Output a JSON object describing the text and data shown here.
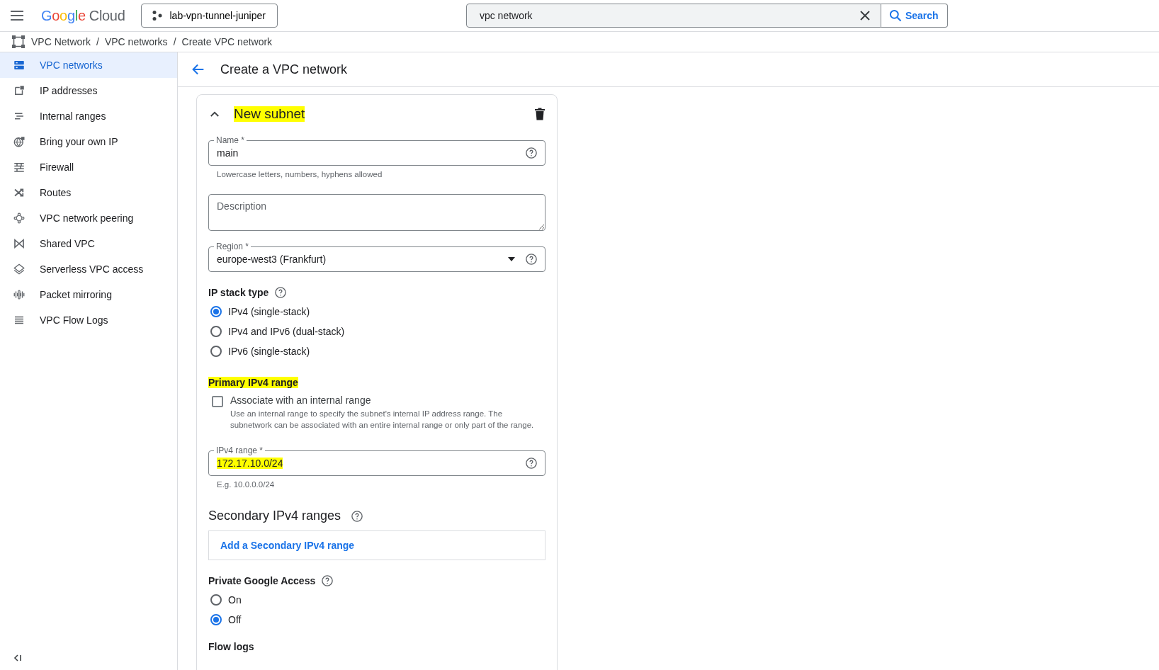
{
  "top_bar": {
    "logo": {
      "brand": "Google",
      "product": "Cloud"
    },
    "project": "lab-vpn-tunnel-juniper",
    "search": {
      "value": "vpc network",
      "button": "Search"
    }
  },
  "breadcrumbs": [
    "VPC Network",
    "VPC networks",
    "Create VPC network"
  ],
  "breadcrumb_separator": "/",
  "sidebar": {
    "items": [
      {
        "label": "VPC networks",
        "selected": true
      },
      {
        "label": "IP addresses",
        "selected": false
      },
      {
        "label": "Internal ranges",
        "selected": false
      },
      {
        "label": "Bring your own IP",
        "selected": false
      },
      {
        "label": "Firewall",
        "selected": false
      },
      {
        "label": "Routes",
        "selected": false
      },
      {
        "label": "VPC network peering",
        "selected": false
      },
      {
        "label": "Shared VPC",
        "selected": false
      },
      {
        "label": "Serverless VPC access",
        "selected": false
      },
      {
        "label": "Packet mirroring",
        "selected": false
      },
      {
        "label": "VPC Flow Logs",
        "selected": false
      }
    ]
  },
  "page": {
    "title": "Create a VPC network"
  },
  "subnet_card": {
    "title": "New subnet",
    "title_highlighted": true,
    "expanded": true,
    "name_field": {
      "label": "Name *",
      "value": "main",
      "hint": "Lowercase letters, numbers, hyphens allowed"
    },
    "description_field": {
      "placeholder": "Description"
    },
    "region_field": {
      "label": "Region *",
      "value": "europe-west3 (Frankfurt)"
    },
    "ip_stack": {
      "label": "IP stack type",
      "options": [
        {
          "label": "IPv4 (single-stack)",
          "selected": true
        },
        {
          "label": "IPv4 and IPv6 (dual-stack)",
          "selected": false
        },
        {
          "label": "IPv6 (single-stack)",
          "selected": false
        }
      ]
    },
    "primary_range": {
      "heading": "Primary IPv4 range",
      "heading_highlighted": true,
      "associate": {
        "label": "Associate with an internal range",
        "checked": false,
        "description": "Use an internal range to specify the subnet's internal IP address range. The subnetwork can be associated with an entire internal range or only part of the range."
      },
      "ipv4_field": {
        "label": "IPv4 range *",
        "value": "172.17.10.0/24",
        "value_highlighted": true,
        "hint": "E.g. 10.0.0.0/24"
      }
    },
    "secondary": {
      "heading": "Secondary IPv4 ranges",
      "add_button": "Add a Secondary IPv4 range"
    },
    "private_access": {
      "label": "Private Google Access",
      "options": [
        {
          "label": "On",
          "selected": false
        },
        {
          "label": "Off",
          "selected": true
        }
      ]
    },
    "flow_logs": {
      "label": "Flow logs"
    }
  }
}
